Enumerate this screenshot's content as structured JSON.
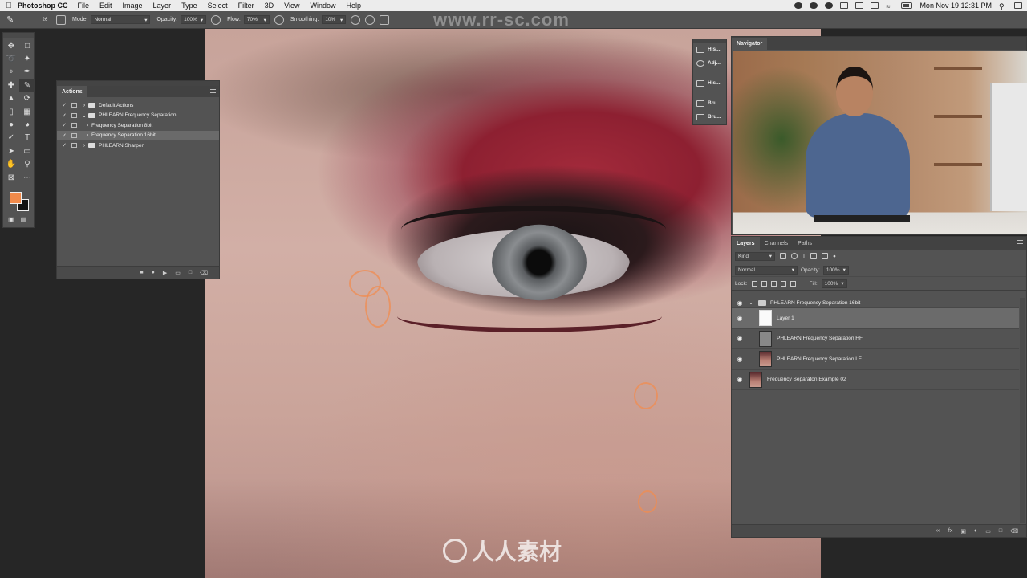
{
  "menubar": {
    "app_name": "Photoshop CC",
    "items": [
      "File",
      "Edit",
      "Image",
      "Layer",
      "Type",
      "Select",
      "Filter",
      "3D",
      "View",
      "Window",
      "Help"
    ],
    "datetime": "Mon Nov 19  12:31 PM"
  },
  "options": {
    "brush_size": "26",
    "mode_label": "Mode:",
    "mode_value": "Normal",
    "opacity_label": "Opacity:",
    "opacity_value": "100%",
    "flow_label": "Flow:",
    "flow_value": "70%",
    "smoothing_label": "Smoothing:",
    "smoothing_value": "10%"
  },
  "watermark": "www.rr-sc.com",
  "logo_text": "人人素材",
  "swatches": {
    "foreground": "#f08a4b",
    "background": "#111111"
  },
  "strip": {
    "items": [
      {
        "label": "His...",
        "icon": "history-icon"
      },
      {
        "label": "Adj...",
        "icon": "adjustments-icon"
      },
      {
        "label": "His...",
        "icon": "histogram-icon"
      },
      {
        "label": "Bru...",
        "icon": "brush-icon"
      },
      {
        "label": "Bru...",
        "icon": "brush-settings-icon"
      }
    ]
  },
  "actions": {
    "title": "Actions",
    "rows": [
      {
        "label": "Default Actions",
        "type": "set",
        "expanded": false
      },
      {
        "label": "PHLEARN Frequency Separation",
        "type": "set",
        "expanded": true
      },
      {
        "label": "Frequency Separation 8bit",
        "type": "action"
      },
      {
        "label": "Frequency Separation 16bit",
        "type": "action",
        "selected": true
      },
      {
        "label": "PHLEARN Sharpen",
        "type": "set",
        "expanded": false
      }
    ]
  },
  "navigator": {
    "title": "Navigator"
  },
  "layers": {
    "tabs": [
      "Layers",
      "Channels",
      "Paths"
    ],
    "filter_label": "Kind",
    "blend_mode": "Normal",
    "opacity_label": "Opacity:",
    "opacity_value": "100%",
    "lock_label": "Lock:",
    "fill_label": "Fill:",
    "fill_value": "100%",
    "group_name": "PHLEARN Frequency Separation 16bit",
    "rows": [
      {
        "name": "Layer 1",
        "thumb": "white",
        "selected": true
      },
      {
        "name": "PHLEARN Frequency Separation HF",
        "thumb": "grey"
      },
      {
        "name": "PHLEARN Frequency Separation LF",
        "thumb": "face"
      }
    ],
    "background_layer": "Frequency Separaton Example 02"
  }
}
